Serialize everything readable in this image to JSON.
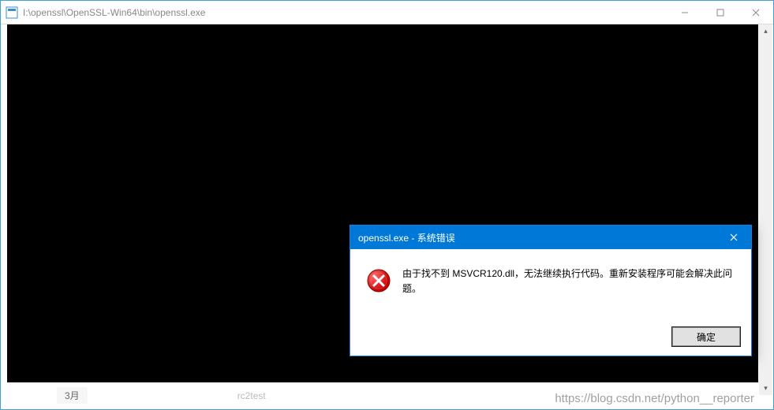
{
  "main_window": {
    "title": "I:\\openssl\\OpenSSL-Win64\\bin\\openssl.exe"
  },
  "bottom_strip": {
    "folder_label": "3月",
    "faded_file": "rc2test",
    "watermark": "https://blog.csdn.net/python__reporter"
  },
  "error_dialog": {
    "title": "openssl.exe - 系统错误",
    "message": "由于找不到 MSVCR120.dll，无法继续执行代码。重新安装程序可能会解决此问题。",
    "ok_label": "确定"
  },
  "scroll": {
    "up": "▴",
    "down": "▾"
  }
}
